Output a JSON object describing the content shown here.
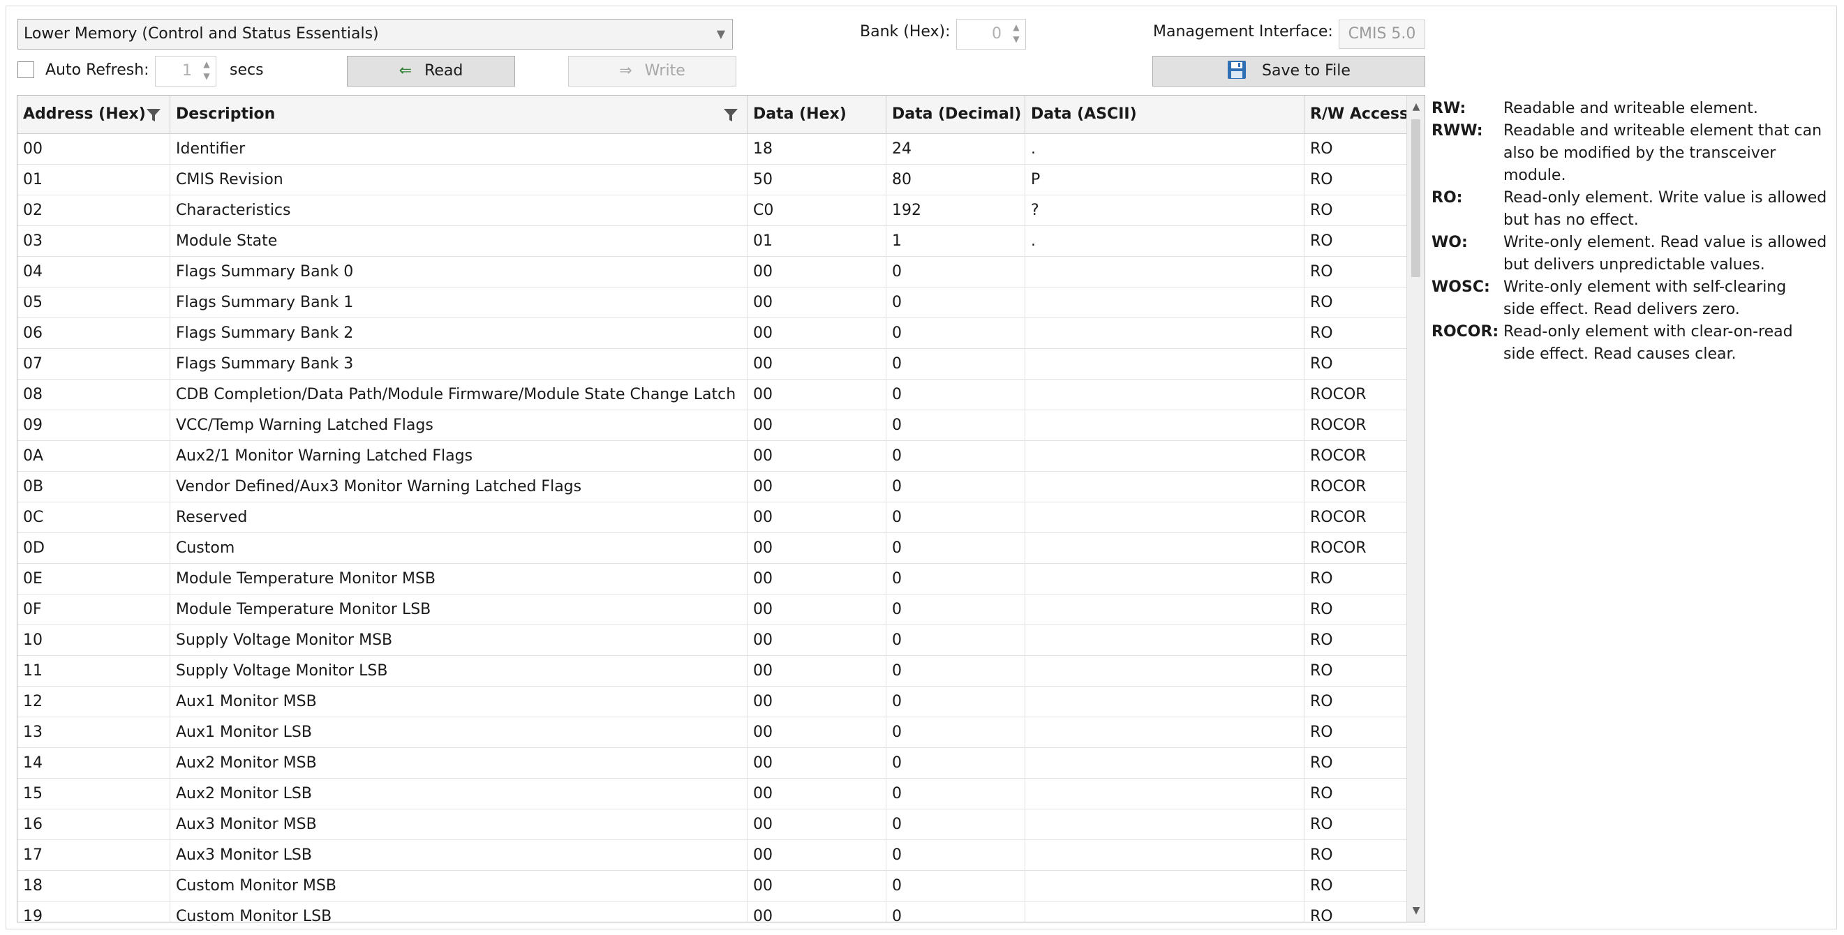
{
  "toolbar": {
    "memory_select": "Lower Memory (Control and Status Essentials)",
    "bank_label": "Bank (Hex):",
    "bank_value": "0",
    "management_label": "Management Interface:",
    "management_value": "CMIS 5.0",
    "auto_refresh_label": "Auto Refresh:",
    "auto_refresh_checked": false,
    "refresh_value": "1",
    "secs_label": "secs",
    "read_label": "Read",
    "write_label": "Write",
    "save_label": "Save to File"
  },
  "table": {
    "columns": [
      "Address (Hex)",
      "Description",
      "Data (Hex)",
      "Data (Decimal)",
      "Data (ASCII)",
      "R/W Access"
    ],
    "rows": [
      [
        "00",
        "Identifier",
        "18",
        "24",
        ".",
        "RO"
      ],
      [
        "01",
        "CMIS Revision",
        "50",
        "80",
        "P",
        "RO"
      ],
      [
        "02",
        "Characteristics",
        "C0",
        "192",
        "?",
        "RO"
      ],
      [
        "03",
        "Module State",
        "01",
        "1",
        ".",
        "RO"
      ],
      [
        "04",
        "Flags Summary Bank 0",
        "00",
        "0",
        "",
        "RO"
      ],
      [
        "05",
        "Flags Summary Bank 1",
        "00",
        "0",
        "",
        "RO"
      ],
      [
        "06",
        "Flags Summary Bank 2",
        "00",
        "0",
        "",
        "RO"
      ],
      [
        "07",
        "Flags Summary Bank 3",
        "00",
        "0",
        "",
        "RO"
      ],
      [
        "08",
        "CDB Completion/Data Path/Module Firmware/Module State Change Latch",
        "00",
        "0",
        "",
        "ROCOR"
      ],
      [
        "09",
        "VCC/Temp Warning Latched Flags",
        "00",
        "0",
        "",
        "ROCOR"
      ],
      [
        "0A",
        "Aux2/1 Monitor Warning Latched Flags",
        "00",
        "0",
        "",
        "ROCOR"
      ],
      [
        "0B",
        "Vendor Defined/Aux3 Monitor Warning Latched Flags",
        "00",
        "0",
        "",
        "ROCOR"
      ],
      [
        "0C",
        "Reserved",
        "00",
        "0",
        "",
        "ROCOR"
      ],
      [
        "0D",
        "Custom",
        "00",
        "0",
        "",
        "ROCOR"
      ],
      [
        "0E",
        "Module Temperature Monitor MSB",
        "00",
        "0",
        "",
        "RO"
      ],
      [
        "0F",
        "Module Temperature Monitor LSB",
        "00",
        "0",
        "",
        "RO"
      ],
      [
        "10",
        "Supply Voltage Monitor MSB",
        "00",
        "0",
        "",
        "RO"
      ],
      [
        "11",
        "Supply Voltage Monitor LSB",
        "00",
        "0",
        "",
        "RO"
      ],
      [
        "12",
        "Aux1 Monitor MSB",
        "00",
        "0",
        "",
        "RO"
      ],
      [
        "13",
        "Aux1 Monitor LSB",
        "00",
        "0",
        "",
        "RO"
      ],
      [
        "14",
        "Aux2 Monitor MSB",
        "00",
        "0",
        "",
        "RO"
      ],
      [
        "15",
        "Aux2 Monitor LSB",
        "00",
        "0",
        "",
        "RO"
      ],
      [
        "16",
        "Aux3 Monitor MSB",
        "00",
        "0",
        "",
        "RO"
      ],
      [
        "17",
        "Aux3 Monitor LSB",
        "00",
        "0",
        "",
        "RO"
      ],
      [
        "18",
        "Custom Monitor MSB",
        "00",
        "0",
        "",
        "RO"
      ],
      [
        "19",
        "Custom Monitor LSB",
        "00",
        "0",
        "",
        "RO"
      ]
    ]
  },
  "legend": [
    {
      "key": "RW:",
      "desc": [
        "Readable and writeable element."
      ]
    },
    {
      "key": "RWW:",
      "desc": [
        "Readable and writeable element that can",
        "also be modified by the transceiver module."
      ]
    },
    {
      "key": "RO:",
      "desc": [
        "Read-only element. Write value is allowed",
        "but has no effect."
      ]
    },
    {
      "key": "WO:",
      "desc": [
        "Write-only element. Read value is allowed",
        "but delivers unpredictable values."
      ]
    },
    {
      "key": "WOSC:",
      "desc": [
        "Write-only element with self-clearing",
        "side effect. Read delivers zero."
      ]
    },
    {
      "key": "ROCOR:",
      "desc": [
        "Read-only element with clear-on-read",
        "side effect. Read causes clear."
      ]
    }
  ],
  "icons": {
    "read_icon": "arrow-left-icon",
    "write_icon": "arrow-right-icon",
    "save_icon": "floppy-disk-icon",
    "filter_icon": "funnel-filter-icon"
  }
}
